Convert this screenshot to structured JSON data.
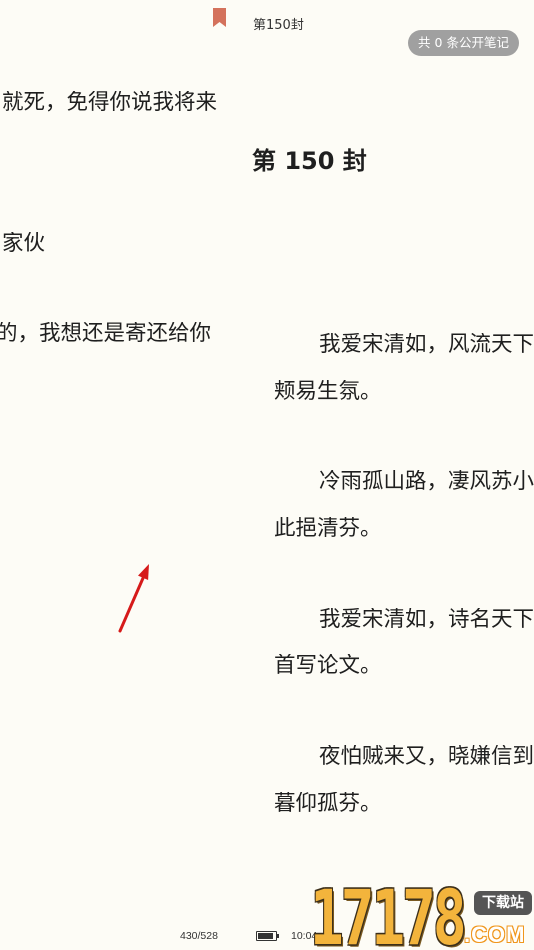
{
  "reader": {
    "header_title": "第150封",
    "notes_button_label": "共 0 条公开笔记",
    "bookmark_icon": "bookmark-icon",
    "bookmark_color": "#d4725c",
    "background_color": "#fdfcf6",
    "text_color": "#1f1f1f",
    "notes_button_color": "#a0a0a0"
  },
  "left_page": {
    "lines": [
      "就死，免得你说我将来",
      "家伙",
      "的，我想还是寄还给你"
    ]
  },
  "right_page": {
    "chapter_title": "第 150 封",
    "paragraphs": [
      [
        "我爱宋清如，风流天下",
        "颊易生氛。"
      ],
      [
        "冷雨孤山路，凄风苏小",
        "此挹清芬。"
      ],
      [
        "我爱宋清如，诗名天下",
        "首写论文。"
      ],
      [
        "夜怕贼来又，晓嫌信到",
        "暮仰孤芬。"
      ]
    ]
  },
  "status_bar": {
    "page_progress": "430/528",
    "battery_icon": "battery-icon",
    "battery_level": 0.9,
    "time": "10:04"
  },
  "annotation": {
    "arrow_icon": "red-arrow-icon",
    "arrow_color": "#d61a1a"
  },
  "watermark": {
    "digits": "17178",
    "badge_text": "下载站",
    "suffix": ".COM",
    "digit_color": "#f3b43c"
  }
}
